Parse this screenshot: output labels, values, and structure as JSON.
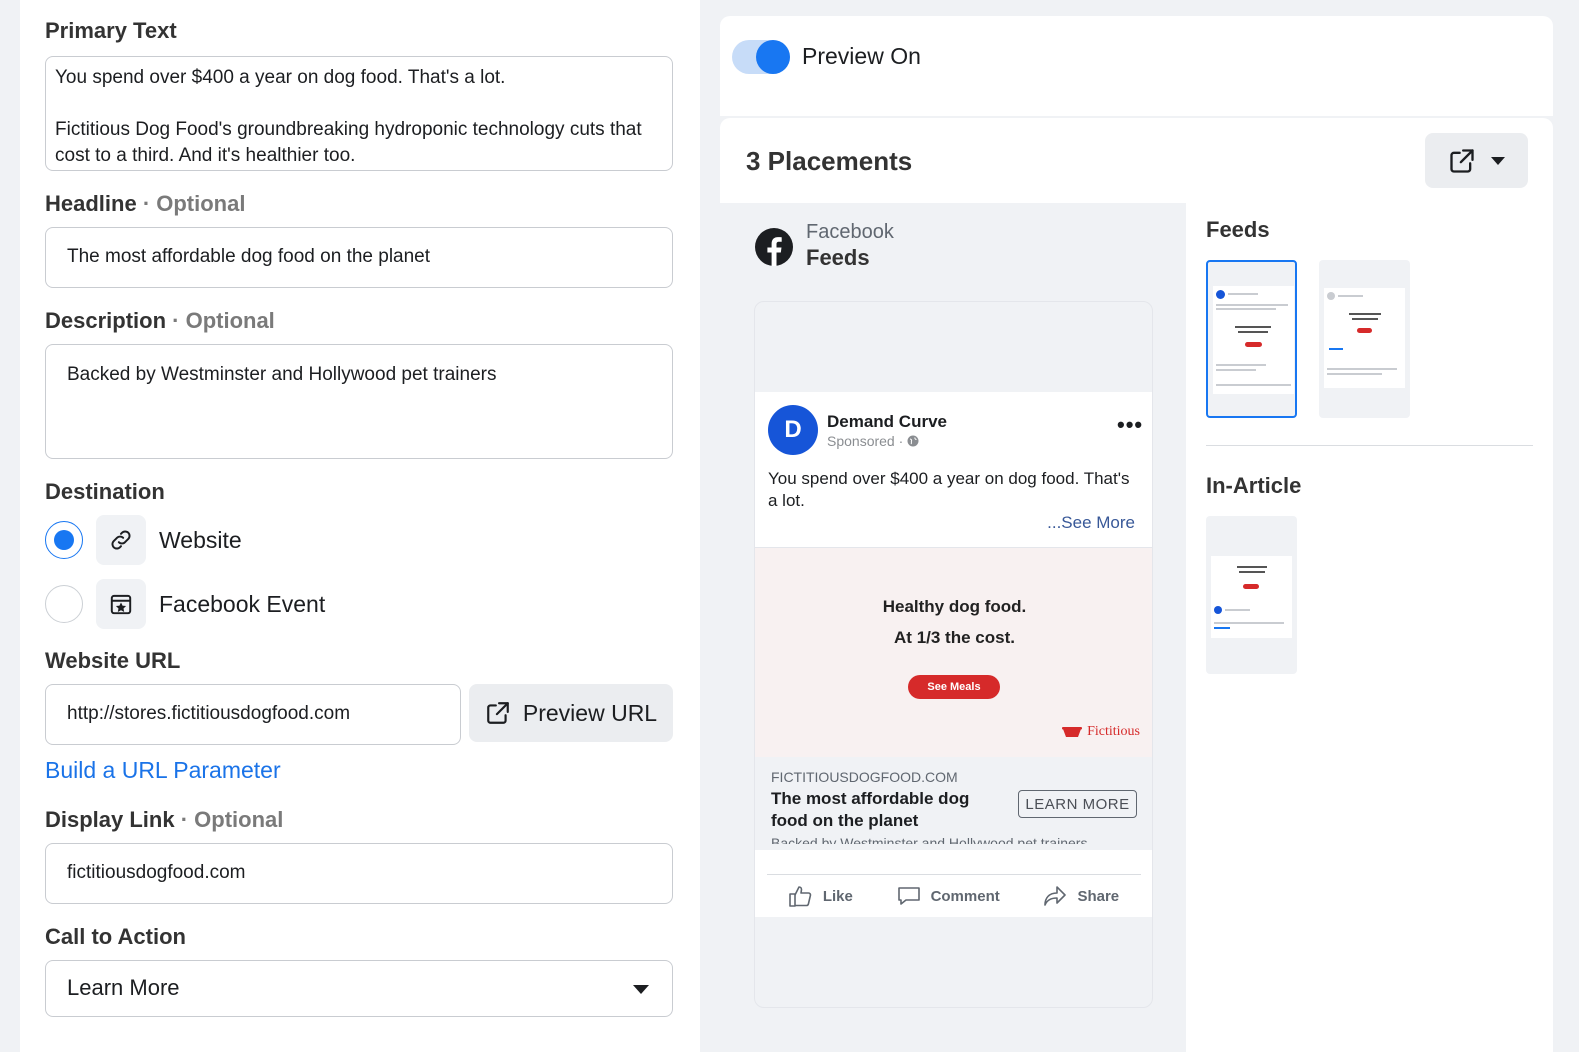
{
  "form": {
    "primary_text": {
      "label": "Primary Text",
      "line1": "You spend over $400 a year on dog food. That's a lot.",
      "line2": "Fictitious Dog Food's groundbreaking hydroponic technology cuts that cost to a third. And it's healthier too."
    },
    "headline": {
      "label": "Headline",
      "optional": " · Optional",
      "value": "The most affordable dog food on the planet"
    },
    "description": {
      "label": "Description",
      "optional": " · Optional",
      "value": "Backed by Westminster and Hollywood pet trainers"
    },
    "destination": {
      "label": "Destination",
      "options": [
        {
          "label": "Website",
          "selected": true
        },
        {
          "label": "Facebook Event",
          "selected": false
        }
      ]
    },
    "website_url": {
      "label": "Website URL",
      "value": "http://stores.fictitiousdogfood.com",
      "preview_label": "Preview URL"
    },
    "build_param_link": "Build a URL Parameter",
    "display_link": {
      "label": "Display Link",
      "optional": " · Optional",
      "value": "fictitiousdogfood.com"
    },
    "cta": {
      "label": "Call to Action",
      "value": "Learn More"
    }
  },
  "preview": {
    "toggle_label": "Preview On",
    "placements_title": "3 Placements",
    "platform": "Facebook",
    "placement": "Feeds",
    "post": {
      "page_name": "Demand Curve",
      "avatar_letter": "D",
      "sponsored": "Sponsored ·",
      "text": "You spend over $400 a year on dog food. That's a lot.",
      "see_more": "...See More",
      "creative_line1": "Healthy dog food.",
      "creative_line2": "At 1/3 the cost.",
      "creative_button": "See Meals",
      "creative_brand": "Fictitious",
      "link_domain": "FICTITIOUSDOGFOOD.COM",
      "link_headline": "The most affordable dog food on the planet",
      "link_description": "Backed by Westminster and Hollywood pet trainers",
      "link_cta": "LEARN MORE",
      "actions": [
        "Like",
        "Comment",
        "Share"
      ]
    },
    "sidebar": {
      "feeds_label": "Feeds",
      "in_article_label": "In-Article"
    }
  },
  "colors": {
    "accent": "#1877f2",
    "brand_red": "#d62a2a",
    "link": "#1a73e8"
  }
}
